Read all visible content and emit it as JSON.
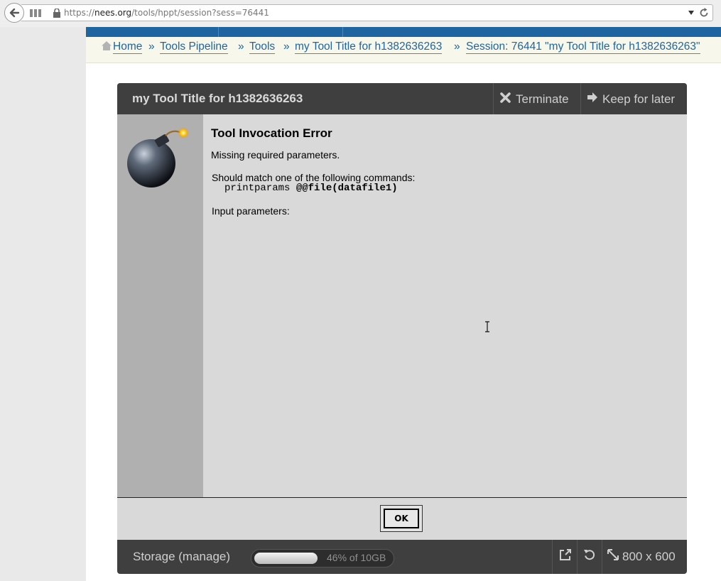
{
  "browser": {
    "url_prefix": "https://",
    "url_host": "nees.org",
    "url_path": "/tools/hppt/session?sess=76441"
  },
  "breadcrumb": {
    "items": [
      "Home",
      "Tools Pipeline",
      "Tools",
      "my Tool Title for h1382636263",
      "Session: 76441 \"my Tool Title for h1382636263\""
    ],
    "separator": "»"
  },
  "tool": {
    "title": "my Tool Title for h1382636263",
    "terminate_label": "Terminate",
    "keep_label": "Keep for later"
  },
  "dialog": {
    "title": "Tool Invocation Error",
    "message": "Missing required parameters.",
    "should_match": "Should match one of the following commands:",
    "command_name": "printparams",
    "command_args": "@@file(datafile1)",
    "input_params": "Input parameters:",
    "ok_label": "OK"
  },
  "footer": {
    "storage_label": "Storage (manage)",
    "storage_text": "46% of 10GB",
    "storage_fraction": 0.46,
    "size_label": "800 x 600"
  },
  "icons": [
    "back-arrow-icon",
    "apps-icon",
    "lock-icon",
    "dropdown-icon",
    "reload-icon",
    "home-icon",
    "close-icon",
    "arrow-right-icon",
    "bomb-icon",
    "popout-icon",
    "refresh-icon",
    "resize-icon",
    "text-cursor-icon"
  ],
  "colors": {
    "nav_blue": "#1e64a0",
    "link_blue": "#2065a1",
    "header_dark": "#3f3f3f",
    "dialog_bg": "#d9d9d9",
    "sidebar_gray": "#b0b0b0"
  }
}
